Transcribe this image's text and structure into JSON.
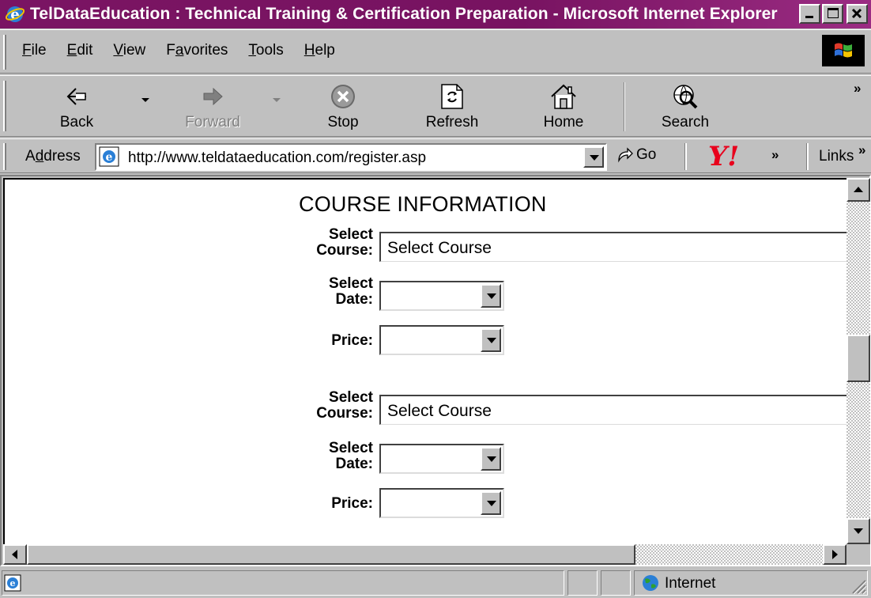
{
  "window": {
    "title": "TelDataEducation : Technical Training & Certification Preparation - Microsoft Internet Explorer",
    "controls": [
      "minimize",
      "maximize",
      "close"
    ]
  },
  "menu": {
    "items": [
      {
        "label": "File",
        "accel": "F",
        "rest": "ile"
      },
      {
        "label": "Edit",
        "accel": "E",
        "rest": "dit"
      },
      {
        "label": "View",
        "accel": "V",
        "rest": "iew"
      },
      {
        "label": "Favorites",
        "pre": "F",
        "accel": "a",
        "rest": "vorites"
      },
      {
        "label": "Tools",
        "accel": "T",
        "rest": "ools"
      },
      {
        "label": "Help",
        "accel": "H",
        "rest": "elp"
      }
    ]
  },
  "toolbar": {
    "back_label": "Back",
    "forward_label": "Forward",
    "stop_label": "Stop",
    "refresh_label": "Refresh",
    "home_label": "Home",
    "search_label": "Search",
    "overflow": "»"
  },
  "address": {
    "label_pre": "A",
    "label_accel": "d",
    "label_rest": "dress",
    "url": "http://www.teldataeducation.com/register.asp",
    "go_label": "Go",
    "more": "»",
    "links_label": "Links",
    "links_more": "»"
  },
  "page": {
    "section_title": "COURSE INFORMATION",
    "group1": {
      "course_label_1": "Select",
      "course_label_2": "Course:",
      "course_value": "Select Course",
      "date_label_1": "Select",
      "date_label_2": "Date:",
      "date_value": "",
      "price_label": "Price:",
      "price_value": ""
    },
    "group2": {
      "course_label_1": "Select",
      "course_label_2": "Course:",
      "course_value": "Select Course",
      "date_label_1": "Select",
      "date_label_2": "Date:",
      "date_value": "",
      "price_label": "Price:",
      "price_value": ""
    }
  },
  "status": {
    "zone": "Internet"
  },
  "colors": {
    "title_bar": "#7a1463",
    "chrome": "#c0c0c0",
    "page_bg": "#ffffff"
  }
}
